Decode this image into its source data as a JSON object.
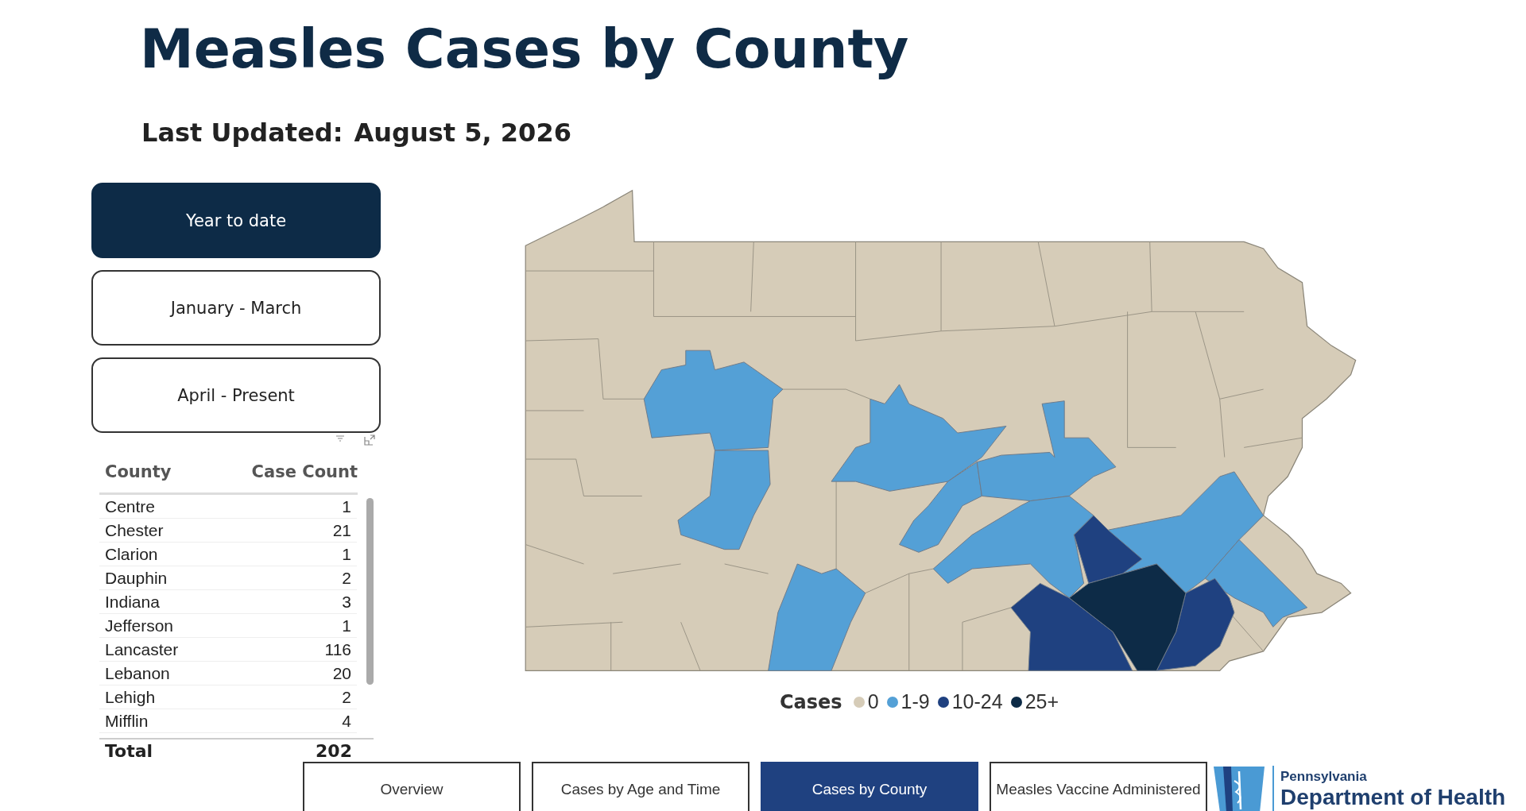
{
  "title": "Measles Cases by County",
  "last_updated": {
    "label": "Last Updated:",
    "value": "August 5, 2026"
  },
  "periods": [
    {
      "label": "Year to date",
      "selected": true
    },
    {
      "label": "January - March",
      "selected": false
    },
    {
      "label": "April - Present",
      "selected": false
    }
  ],
  "table": {
    "columns": [
      "County",
      "Case Count"
    ],
    "rows": [
      {
        "county": "Centre",
        "count": "1"
      },
      {
        "county": "Chester",
        "count": "21"
      },
      {
        "county": "Clarion",
        "count": "1"
      },
      {
        "county": "Dauphin",
        "count": "2"
      },
      {
        "county": "Indiana",
        "count": "3"
      },
      {
        "county": "Jefferson",
        "count": "1"
      },
      {
        "county": "Lancaster",
        "count": "116"
      },
      {
        "county": "Lebanon",
        "count": "20"
      },
      {
        "county": "Lehigh",
        "count": "2"
      },
      {
        "county": "Mifflin",
        "count": "4"
      }
    ],
    "total": {
      "label": "Total",
      "value": "202"
    }
  },
  "legend": {
    "title": "Cases",
    "items": [
      {
        "label": "0",
        "color": "#d6ccb8"
      },
      {
        "label": "1-9",
        "color": "#54a0d6"
      },
      {
        "label": "10-24",
        "color": "#1f4180"
      },
      {
        "label": "25+",
        "color": "#0d2b47"
      }
    ]
  },
  "nav": [
    {
      "label": "Overview",
      "selected": false
    },
    {
      "label": "Cases by Age and Time",
      "selected": false
    },
    {
      "label": "Cases by County",
      "selected": true
    },
    {
      "label": "Measles Vaccine Administered",
      "selected": false
    }
  ],
  "logo": {
    "line1": "Pennsylvania",
    "line2": "Department of Health"
  }
}
